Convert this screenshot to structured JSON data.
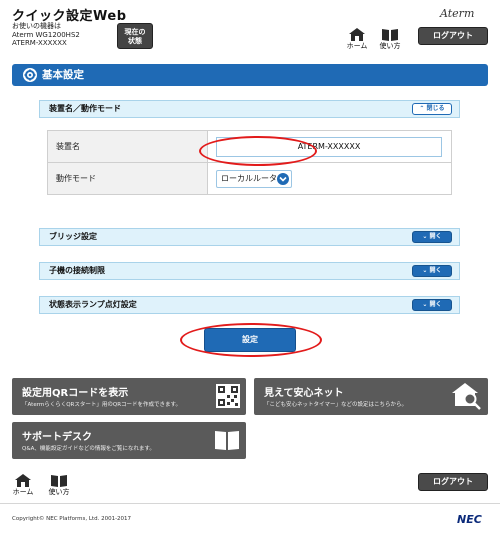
{
  "header": {
    "title": "クイック設定Web",
    "device_line1": "お使いの機器は",
    "device_line2": "Aterm WG1200HS2",
    "device_line3": "ATERM-XXXXXX",
    "status_button": "現在の\n状態",
    "brand": "Aterm",
    "home_label": "ホーム",
    "help_label": "使い方",
    "logout_label": "ログアウト"
  },
  "section": {
    "title": "基本設定"
  },
  "panels": {
    "device_mode": {
      "title": "装置名／動作モード",
      "toggle": "閉じる"
    },
    "bridge": {
      "title": "ブリッジ設定",
      "toggle": "開く"
    },
    "client_limit": {
      "title": "子機の接続制限",
      "toggle": "開く"
    },
    "lamp": {
      "title": "状態表示ランプ点灯設定",
      "toggle": "開く"
    }
  },
  "form": {
    "device_name_label": "装置名",
    "device_name_value": "ATERM-XXXXXX",
    "mode_label": "動作モード",
    "mode_value": "ローカルルータ"
  },
  "actions": {
    "set_label": "設定"
  },
  "tiles": {
    "qr": {
      "title": "設定用QRコードを表示",
      "desc": "「AtermらくらくQRスタート」用のQRコードを作成できます。"
    },
    "safety": {
      "title": "見えて安心ネット",
      "desc": "「こども安心ネットタイマー」などの設定はこちらから。"
    },
    "support": {
      "title": "サポートデスク",
      "desc": "Q&A、機能設定ガイドなどの情報をご覧になれます。"
    }
  },
  "footer": {
    "home_label": "ホーム",
    "help_label": "使い方",
    "logout_label": "ログアウト",
    "copyright": "Copyright© NEC Platforms, Ltd. 2001-2017",
    "brand": "NEC"
  },
  "colors": {
    "accent": "#1f6ab5",
    "highlight": "#e21b1b",
    "tile": "#5a5a5a"
  }
}
